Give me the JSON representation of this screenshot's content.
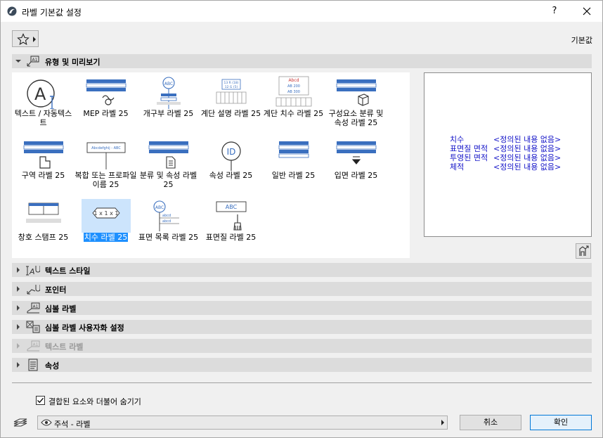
{
  "window": {
    "title": "라벨 기본값 설정",
    "help_label": "?"
  },
  "toolbar": {
    "preset_label": "기본값"
  },
  "sections": {
    "types": "유형 및 미리보기",
    "text_style": "텍스트 스타일",
    "pointer": "포인터",
    "symbol_label": "심볼 라벨",
    "symbol_custom": "심볼 라벨 사용자화 설정",
    "text_label": "텍스트 라벨",
    "properties": "속성"
  },
  "palette": {
    "items": [
      {
        "label": "텍스트 / 자동텍스트"
      },
      {
        "label": "MEP 라벨 25"
      },
      {
        "label": "개구부 라벨 25"
      },
      {
        "label": "계단 설명 라벨 25"
      },
      {
        "label": "계단 치수 라벨 25"
      },
      {
        "label": "구성요소 분류 및 속성 라벨 25"
      },
      {
        "label": "구역 라벨 25"
      },
      {
        "label": "복합 또는 프로파일 이름 25"
      },
      {
        "label": "분류 및 속성 라벨 25"
      },
      {
        "label": "속성 라벨 25"
      },
      {
        "label": "일반 라벨 25"
      },
      {
        "label": "입면 라벨 25"
      },
      {
        "label": "창호 스탬프 25"
      },
      {
        "label": "치수 라벨 25"
      },
      {
        "label": "표면 목록 라벨 25"
      },
      {
        "label": "표면질 라벨 25"
      }
    ],
    "thumb_text": {
      "abc": "ABC",
      "id": "ID",
      "profile": "Abcdefghij - ABC",
      "dim": "1 x 1 x 1",
      "stair_top": "13 R (18)",
      "stair_bottom": "12 G (5)",
      "stair_dim_top": "Abcd",
      "stair_dim_mid": "AB  200",
      "stair_dim_bottom": "AB  300",
      "abcd": "abcd"
    }
  },
  "preview": {
    "rows": [
      {
        "key": "치수",
        "value": "<정의된 내용 없음>"
      },
      {
        "key": "표면질 면적",
        "value": "<정의된 내용 없음>"
      },
      {
        "key": "투영된 면적",
        "value": "<정의된 내용 없음>"
      },
      {
        "key": "체적",
        "value": "<정의된 내용 없음>"
      }
    ],
    "text_color": "#1414c8"
  },
  "options": {
    "hide_with_element": "결합된 요소와 더불어 숨기기",
    "hide_with_element_checked": true
  },
  "layer": {
    "value": "주석 - 라벨"
  },
  "buttons": {
    "cancel": "취소",
    "ok": "확인"
  },
  "colors": {
    "selection": "#1e90ff",
    "thumb_blue": "#3a6fbf",
    "primary_border": "#0078d7"
  }
}
